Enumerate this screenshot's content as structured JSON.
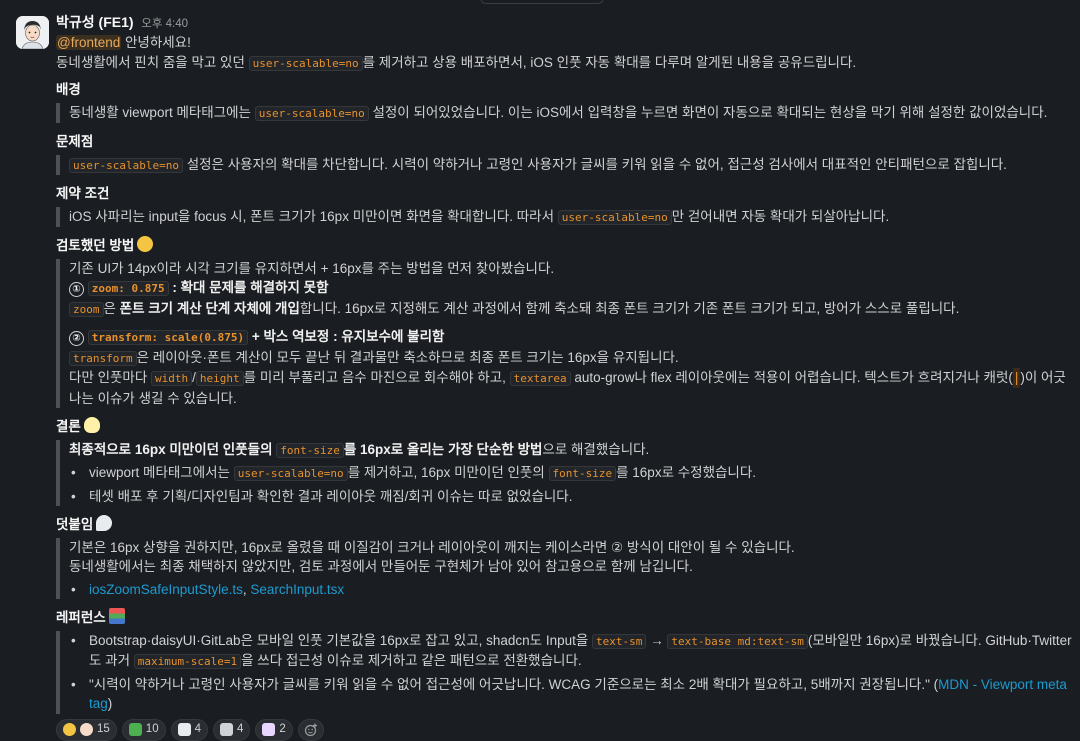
{
  "message": {
    "author": "박규성 (FE1)",
    "time": "오후 4:40",
    "mention": "@frontend",
    "greeting": " 안녕하세요!",
    "intro": [
      "동네생활에서 핀치 줌을 막고 있던 ",
      "user-scalable=no",
      "를 제거하고 상용 배포하면서, iOS 인풋 자동 확대를 다루며 알게된 내용을 공유드립니다."
    ],
    "background": {
      "title": "배경",
      "text": [
        "동네생활 viewport 메타태그에는 ",
        "user-scalable=no",
        " 설정이 되어있었습니다. 이는 iOS에서 입력창을 누르면 화면이 자동으로 확대되는 현상을 막기 위해 설정한 값이었습니다."
      ]
    },
    "problem": {
      "title": "문제점",
      "text": [
        "user-scalable=no",
        " 설정은 사용자의 확대를 차단합니다. 시력이 약하거나 고령인 사용자가 글씨를 키워 읽을 수 없어, 접근성 검사에서 대표적인 안티패턴으로 잡힙니다."
      ]
    },
    "constraint": {
      "title": "제약 조건",
      "text": [
        "iOS 사파리는 input을 focus 시, 폰트 크기가 16px 미만이면 화면을 확대합니다. 따라서 ",
        "user-scalable=no",
        "만 걷어내면 자동 확대가 되살아납니다."
      ]
    },
    "approach": {
      "title": "검토했던 방법",
      "emoji": "thinking-face",
      "lead": "기존 UI가 14px이라 시각 크기를 유지하면서 + 16px를 주는 방법을 먼저 찾아봤습니다.",
      "opt1_num": "①",
      "opt1_code": "zoom: 0.875",
      "opt1_title": " : 확대 문제를 해결하지 못함",
      "opt1_desc": [
        "zoom",
        "은 ",
        "폰트 크기 계산 단계 자체에 개입",
        "합니다. 16px로 지정해도 계산 과정에서 함께 축소돼 최종 폰트 크기가 기존 폰트 크기가 되고, 방어가 스스로 풀립니다."
      ],
      "opt2_num": "②",
      "opt2_code": "transform: scale(0.875)",
      "opt2_title": " + 박스 역보정 : 유지보수에 불리함",
      "opt2_desc1": [
        "transform",
        "은 레이아웃·폰트 계산이 모두 끝난 뒤 결과물만 축소하므로 최종 폰트 크기는 16px을 유지됩니다."
      ],
      "opt2_desc2": [
        "다만 인풋마다 ",
        "width",
        "/",
        "height",
        "를 미리 부풀리고 음수 마진으로 회수해야 하고, ",
        "textarea",
        " auto-grow나 flex 레이아웃에는 적용이 어렵습니다. 텍스트가 흐려지거나 캐럿(",
        "|",
        ")이 어긋나는 이슈가 생길 수 있습니다."
      ]
    },
    "conclusion": {
      "title": "결론",
      "emoji": "light-bulb",
      "lead": [
        "최종적으로 16px 미만이던 인풋들의 ",
        "font-size",
        "를 16px로 올리는 가장 단순한 방법",
        "으로 해결했습니다."
      ],
      "b1": [
        "viewport 메타태그에서는 ",
        "user-scalable=no",
        "를 제거하고, 16px 미만이던 인풋의 ",
        "font-size",
        "를 16px로 수정했습니다."
      ],
      "b2": "테셋 배포 후 기획/디자인팀과 확인한 결과 레이아웃 깨짐/회귀 이슈는 따로 없었습니다."
    },
    "addendum": {
      "title": "덧붙임",
      "emoji": "speech-balloon",
      "l1": "기본은 16px 상향을 권하지만, 16px로 올렸을 때 이질감이 크거나 레이아웃이 깨지는 케이스라면 ② 방식이 대안이 될 수 있습니다.",
      "l2": "동네생활에서는 최종 채택하지 않았지만, 검토 과정에서 만들어둔 구현체가 남아 있어 참고용으로 함께 남깁니다.",
      "link1": "iosZoomSafeInputStyle.ts",
      "sep": ", ",
      "link2": "SearchInput.tsx"
    },
    "references": {
      "title": "레퍼런스",
      "emoji": "books",
      "r1": [
        "Bootstrap·daisyUI·GitLab은 모바일 인풋 기본값을 16px로 잡고 있고, shadcn도 Input을 ",
        "text-sm",
        " → ",
        "text-base md:text-sm",
        "(모바일만 16px)로 바꿨습니다. GitHub·Twitter도 과거 ",
        "maximum-scale=1",
        "을 쓰다 접근성 이슈로 제거하고 같은 패턴으로 전환했습니다."
      ],
      "r2": "\"시력이 약하거나 고령인 사용자가 글씨를 키워 읽을 수 없어 접근성에 어긋납니다. WCAG 기준으로는 최소 2배 확대가 필요하고, 5배까지 권장됩니다.\" (",
      "r2_link": "MDN - Viewport meta tag",
      "r2_end": ")"
    },
    "reactions": [
      {
        "icon": "thumbs-up",
        "count": "15",
        "color": "#f4c542"
      },
      {
        "icon": "custom-korean",
        "count": "10",
        "color": "#4caf50"
      },
      {
        "icon": "custom-emoji-1",
        "count": "4",
        "color": "#e9ecef"
      },
      {
        "icon": "custom-emoji-2",
        "count": "4",
        "color": "#cfd2d6"
      },
      {
        "icon": "custom-emoji-3",
        "count": "2",
        "color": "#e9d5ff"
      }
    ]
  }
}
